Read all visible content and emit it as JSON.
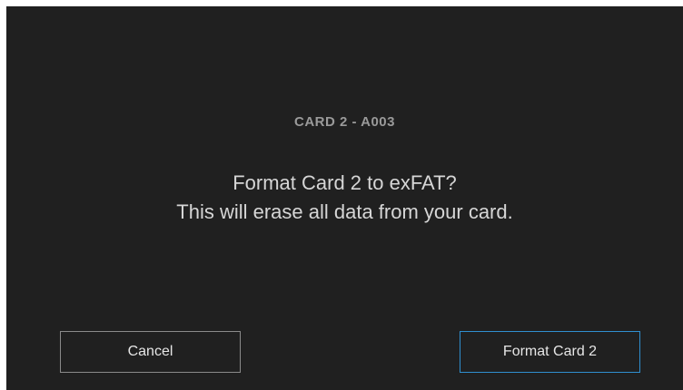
{
  "dialog": {
    "card_label": "CARD 2 - A003",
    "message_line1": "Format Card 2 to exFAT?",
    "message_line2": "This will erase all data from your card."
  },
  "buttons": {
    "cancel_label": "Cancel",
    "confirm_label": "Format Card 2"
  },
  "colors": {
    "background": "#202020",
    "confirm_accent": "#2f8fd0"
  }
}
